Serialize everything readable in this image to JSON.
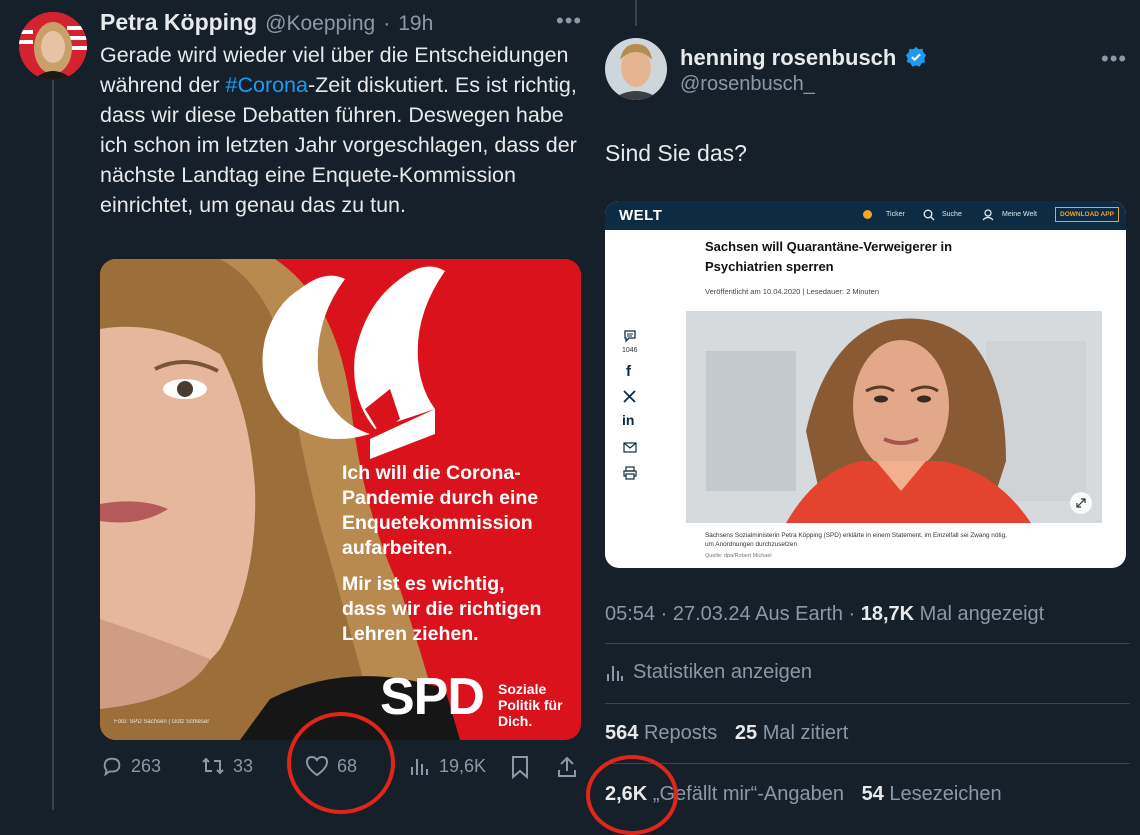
{
  "left_tweet": {
    "author_name": "Petra Köpping",
    "handle": "@Koepping",
    "separator": "·",
    "time": "19h",
    "more": "•••",
    "text_before_hashtag": "Gerade wird wieder viel über die Entscheidungen während der ",
    "hashtag": "#Corona",
    "text_after_hashtag": "-Zeit diskutiert. Es ist richtig, dass wir diese Debatten führen. Deswegen habe ich schon im letzten Jahr vorgeschlagen, dass der nächste Landtag eine Enquete-Kommission einrichtet, um genau das zu tun.",
    "image": {
      "quote_line_1": "Ich will die Corona-",
      "quote_line_2": "Pandemie durch eine",
      "quote_line_3": "Enquetekommission",
      "quote_line_4": "aufarbeiten.",
      "quote_line_5": "Mir ist es wichtig,",
      "quote_line_6": "dass wir die richtigen",
      "quote_line_7": "Lehren ziehen.",
      "logo_text": "SPD",
      "slogan_1": "Soziale",
      "slogan_2": "Politik für",
      "slogan_3": "Dich.",
      "photo_credit": "Foto: SPD Sachsen | Götz Schleser"
    },
    "actions": {
      "replies": "263",
      "reposts": "33",
      "likes": "68",
      "views": "19,6K"
    }
  },
  "right_tweet": {
    "author_name": "henning rosenbusch",
    "handle": "@rosenbusch_",
    "more": "•••",
    "text": "Sind Sie das?",
    "article": {
      "brand": "WELT",
      "nav_ticker": "Ticker",
      "nav_search": "Suche",
      "nav_account": "Meine Welt",
      "download_button": "DOWNLOAD APP",
      "headline_1": "Sachsen will Quarantäne-Verweigerer in",
      "headline_2": "Psychiatrien sperren",
      "meta": "Veröffentlicht am 10.04.2020 | Lesedauer: 2 Minuten",
      "comment_count": "1046",
      "caption_1": "Sachsens Sozialministerin Petra Köpping (SPD) erklärte in einem Statement, im Einzelfall sei Zwang nötig,",
      "caption_2": "um Anordnungen durchzusetzen",
      "caption_source": "Quelle: dpa/Robert Michael"
    },
    "meta_line": {
      "time": "05:54 · 27.03.24 Aus Earth · ",
      "views_count": "18,7K",
      "views_label": " Mal angezeigt"
    },
    "stats_link": "Statistiken anzeigen",
    "reposts_count": "564",
    "reposts_label": "Reposts",
    "quotes_count": "25",
    "quotes_label": "Mal zitiert",
    "likes_count": "2,6K",
    "likes_label": "„Gefällt mir“-Angaben",
    "bookmarks_count": "54",
    "bookmarks_label": "Lesezeichen"
  },
  "colors": {
    "background": "#15202b",
    "accent": "#1d9bf0",
    "spd_red": "#d9121c",
    "welt_navy": "#0d2b42",
    "highlight_circle": "#e0261b"
  }
}
